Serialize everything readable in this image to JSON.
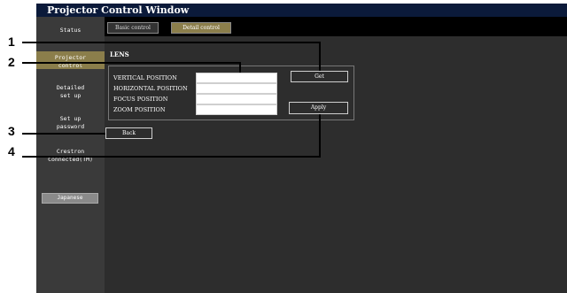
{
  "window": {
    "title": "Projector Control Window"
  },
  "top_tabs": [
    {
      "label": "Basic control"
    },
    {
      "label": "Detail control"
    }
  ],
  "sidebar": {
    "items": [
      {
        "label_lines": [
          "Status"
        ]
      },
      {
        "label_lines": [
          "Projector",
          "control"
        ]
      },
      {
        "label_lines": [
          "Detailed",
          "set up"
        ]
      },
      {
        "label_lines": [
          "Set up",
          "password"
        ]
      },
      {
        "label_lines": [
          "Crestron",
          "Connected(TM)"
        ]
      }
    ],
    "language_button": "Japanese"
  },
  "lens": {
    "title": "LENS",
    "fields": [
      {
        "label": "VERTICAL POSITION",
        "value": ""
      },
      {
        "label": "HORIZONTAL POSITION",
        "value": ""
      },
      {
        "label": "FOCUS POSITION",
        "value": ""
      },
      {
        "label": "ZOOM POSITION",
        "value": ""
      }
    ],
    "get_label": "Get",
    "apply_label": "Apply",
    "back_label": "Back"
  },
  "callouts": [
    "1",
    "2",
    "3",
    "4"
  ],
  "colors": {
    "title_bg": "#0b1a3a",
    "active_tab": "#8b7e4b",
    "sidebar_bg": "#3a3a3a",
    "content_bg": "#2d2d2d"
  }
}
